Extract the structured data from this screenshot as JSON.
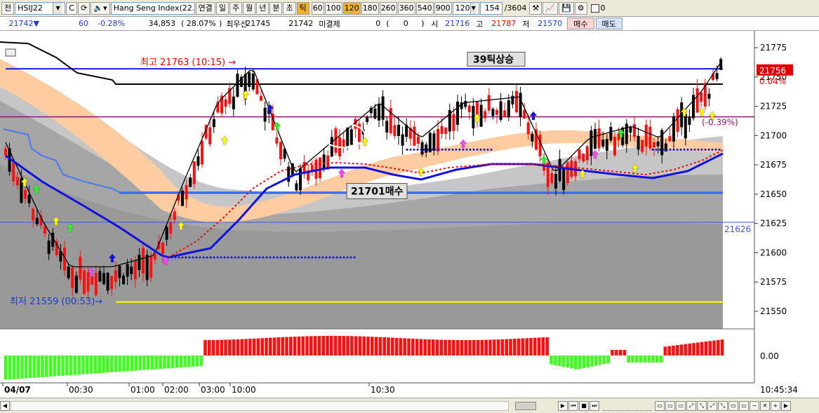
{
  "toolbar": {
    "type_label": "전",
    "symbol": "HSIJ22",
    "name": "Hang Seng Index(22.0",
    "view_modes": [
      "연결",
      "일",
      "주",
      "월",
      "년",
      "분",
      "초",
      "틱"
    ],
    "active_mode": "틱",
    "intervals": [
      "60",
      "100",
      "120",
      "180",
      "260",
      "360",
      "540",
      "900"
    ],
    "active_interval": "120",
    "interval_value": "120",
    "count": "154",
    "total": "/3604",
    "check_value": "0"
  },
  "quote": {
    "price": "21742",
    "change": "60",
    "change_pct": "-0.28%",
    "volume": "34,853",
    "volume_pct": "( 28.07%",
    "best_label": "최우선",
    "best_bid": "21745",
    "best_ask": "21742",
    "unfilled_label": "미결제",
    "unfilled": "0",
    "unfilled_open": "(",
    "unfilled_chg": "0",
    "unfilled_close": ")",
    "open_label": "시",
    "open": "21716",
    "high_label": "고",
    "high": "21787",
    "low_label": "저",
    "low": "21570",
    "buy_button": "매수",
    "sell_button": "매도"
  },
  "chart": {
    "price_labels": [
      "21775",
      "21750",
      "21725",
      "21700",
      "21675",
      "21650",
      "21625",
      "21600",
      "21575",
      "21550"
    ],
    "current_price": "21756",
    "current_pct": "0.04%",
    "level_label": "21626",
    "high_marker": "최고 21763 (10:15)",
    "low_marker": "최저 21559 (00:53)",
    "annotation_rise": "39틱상승",
    "annotation_buy": "21701매수",
    "ma_label": "(-0.39%)",
    "macd_zero_label": "0.00",
    "time_labels": [
      "04/07",
      "00:30",
      "01:00",
      "02:00",
      "03:00",
      "10:00",
      "10:30"
    ],
    "clock": "10:45:34",
    "colors": {
      "up": "#ff1010",
      "down": "#000000",
      "signal_yellow": "#ffff00",
      "signal_green": "#22ff22",
      "signal_magenta": "#ff44ff",
      "ma_blue": "#1010e0",
      "ma_black": "#000000",
      "band_peach": "#ffcba0",
      "line_purple": "#8a1a6a",
      "line_yellow": "#ffff00"
    }
  }
}
